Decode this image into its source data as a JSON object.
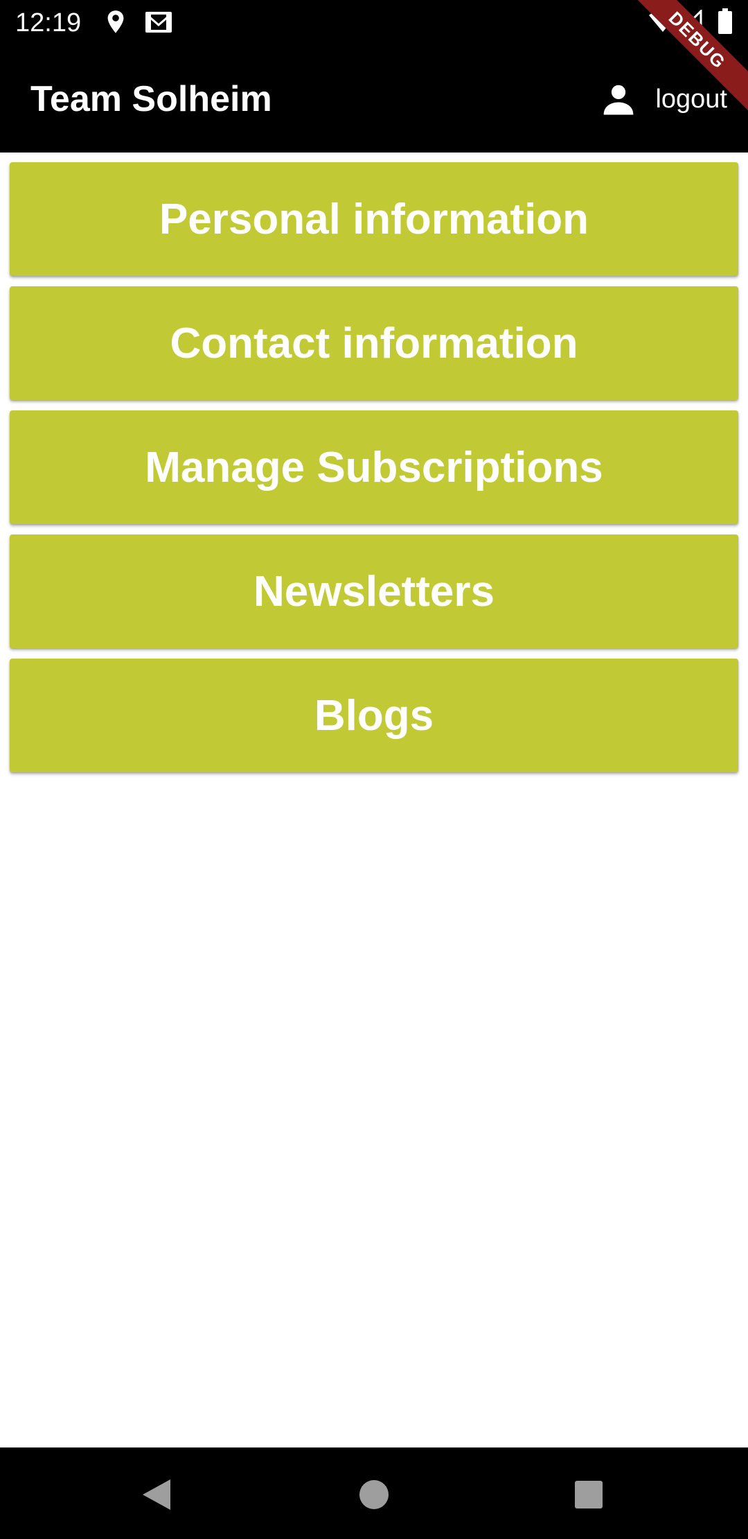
{
  "status_bar": {
    "time": "12:19",
    "icons": [
      "location-icon",
      "gmail-icon",
      "wifi-icon",
      "signal-icon",
      "battery-icon"
    ]
  },
  "app_bar": {
    "title": "Team Solheim",
    "logout_label": "logout",
    "logout_icon": "person-icon"
  },
  "debug_banner": "DEBUG",
  "menu": {
    "items": [
      {
        "label": "Personal information"
      },
      {
        "label": "Contact information"
      },
      {
        "label": "Manage Subscriptions"
      },
      {
        "label": "Newsletters"
      },
      {
        "label": "Blogs"
      }
    ]
  },
  "nav_bar": {
    "buttons": [
      "back-icon",
      "home-icon",
      "recents-icon"
    ]
  },
  "colors": {
    "app_bar": "#000000",
    "button": "#c1ca35",
    "button_text": "#ffffff",
    "debug_ribbon": "#8a1c1c"
  }
}
